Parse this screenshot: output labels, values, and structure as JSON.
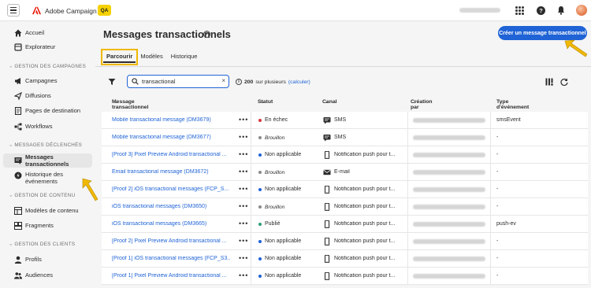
{
  "app": {
    "name": "Adobe Campaign",
    "env_badge": "QA"
  },
  "sidebar": {
    "items_top": [
      {
        "label": "Accueil",
        "icon": "home-icon"
      },
      {
        "label": "Explorateur",
        "icon": "explorer-icon"
      }
    ],
    "sections": [
      {
        "title": "GESTION DES CAMPAGNES",
        "items": [
          {
            "label": "Campagnes",
            "icon": "megaphone-icon"
          },
          {
            "label": "Diffusions",
            "icon": "send-icon"
          },
          {
            "label": "Pages de destination",
            "icon": "page-icon"
          },
          {
            "label": "Workflows",
            "icon": "workflow-icon"
          }
        ]
      },
      {
        "title": "MESSAGES DÉCLENCHÉS",
        "items": [
          {
            "label": "Messages transactionnels",
            "icon": "transactional-icon",
            "active": true
          },
          {
            "label": "Historique des événements",
            "icon": "event-history-icon"
          }
        ]
      },
      {
        "title": "GESTION DE CONTENU",
        "items": [
          {
            "label": "Modèles de contenu",
            "icon": "template-icon"
          },
          {
            "label": "Fragments",
            "icon": "fragment-icon"
          }
        ]
      },
      {
        "title": "GESTION DES CLIENTS",
        "items": [
          {
            "label": "Profils",
            "icon": "profile-icon"
          },
          {
            "label": "Audiences",
            "icon": "audience-icon"
          }
        ]
      }
    ]
  },
  "main": {
    "title": "Messages transactionnels",
    "create_button": "Créer un message transactionnel",
    "tabs": [
      {
        "label": "Parcourir",
        "active": true
      },
      {
        "label": "Modèles"
      },
      {
        "label": "Historique"
      }
    ],
    "search": {
      "value": "transactional"
    },
    "result_count": "200",
    "result_suffix": "sur plusieurs",
    "result_link": "(calculer)",
    "columns": [
      "Message transactionnel",
      "Statut",
      "Canal",
      "Création par",
      "Type d'événement"
    ],
    "rows": [
      {
        "name": "Mobile transactional message (DM3679)",
        "status": "En échec",
        "status_color": "#d7373f",
        "channel": "SMS",
        "channel_icon": "sms-icon",
        "event": "smsEvent"
      },
      {
        "name": "Mobile transactional message (DM3677)",
        "status": "Brouillon",
        "status_color": "#8a8a8a",
        "status_italic": true,
        "channel": "SMS",
        "channel_icon": "sms-icon",
        "event": "-"
      },
      {
        "name": "[Proof 3] Pixel Preview Android transactional ...",
        "status": "Non applicable",
        "status_color": "#1f63d6",
        "channel": "Notification push pour t...",
        "channel_icon": "mobile-icon",
        "event": "-"
      },
      {
        "name": "Email transactional message (DM3672)",
        "status": "Brouillon",
        "status_color": "#8a8a8a",
        "status_italic": true,
        "channel": "E-mail",
        "channel_icon": "email-icon",
        "event": "-"
      },
      {
        "name": "[Proof 2] iOS transactional messages (FCP_S...",
        "status": "Non applicable",
        "status_color": "#1f63d6",
        "channel": "Notification push pour t...",
        "channel_icon": "mobile-icon",
        "event": "-"
      },
      {
        "name": "iOS transactional messages (DM3650)",
        "status": "Brouillon",
        "status_color": "#8a8a8a",
        "status_italic": true,
        "channel": "Notification push pour t...",
        "channel_icon": "mobile-icon",
        "event": "-"
      },
      {
        "name": "iOS transactional messages (DM3665)",
        "status": "Publié",
        "status_color": "#2d9d78",
        "channel": "Notification push pour t...",
        "channel_icon": "mobile-icon",
        "event": "push-ev"
      },
      {
        "name": "[Proof 2] Pixel Preview Android transactional ...",
        "status": "Non applicable",
        "status_color": "#1f63d6",
        "channel": "Notification push pour t...",
        "channel_icon": "mobile-icon",
        "event": "-"
      },
      {
        "name": "[Proof 1] iOS transactional messages (FCP_S3...",
        "status": "Non applicable",
        "status_color": "#1f63d6",
        "channel": "Notification push pour t...",
        "channel_icon": "mobile-icon",
        "event": "-"
      },
      {
        "name": "[Proof 1] Pixel Preview Android transactional ...",
        "status": "Non applicable",
        "status_color": "#1f63d6",
        "channel": "Notification push pour t...",
        "channel_icon": "mobile-icon",
        "event": "-"
      }
    ]
  },
  "colors": {
    "accent": "#1f63d6",
    "highlight": "#f0b800"
  }
}
